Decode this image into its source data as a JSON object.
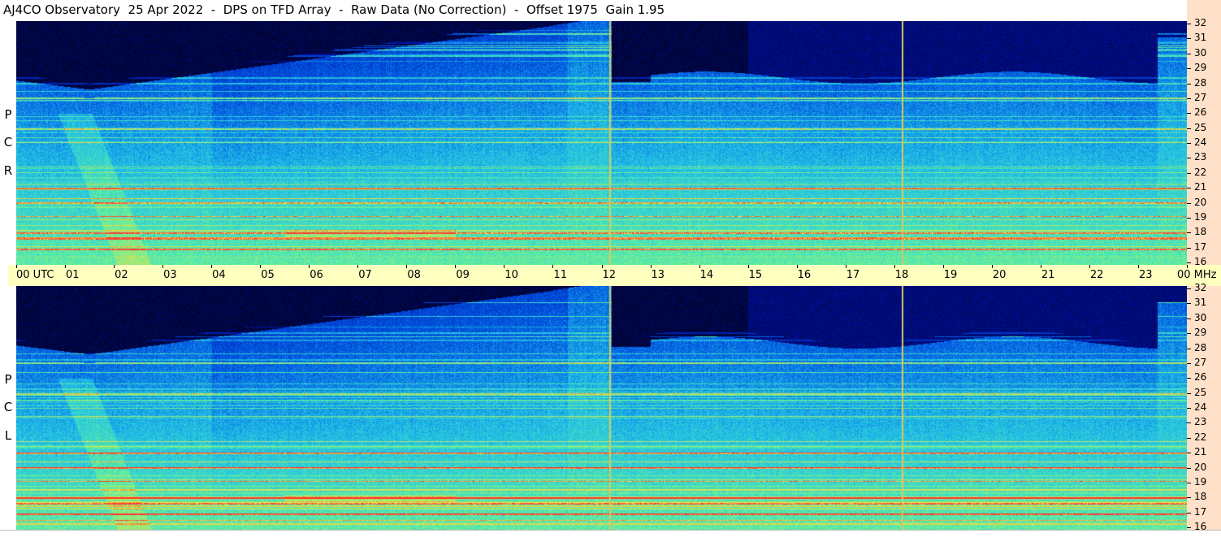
{
  "title": "AJ4CO Observatory  25 Apr 2022  -  DPS on TFD Array  -  Raw Data (No Correction)  -  Offset 1975  Gain 1.95",
  "panels": [
    {
      "id": "rcp",
      "label_letters": [
        "R",
        "C",
        "P"
      ]
    },
    {
      "id": "lcp",
      "label_letters": [
        "L",
        "C",
        "P"
      ]
    }
  ],
  "time_axis": {
    "labels": [
      "00 UTC",
      "01",
      "02",
      "03",
      "04",
      "05",
      "06",
      "07",
      "08",
      "09",
      "10",
      "11",
      "12",
      "13",
      "14",
      "15",
      "16",
      "17",
      "18",
      "19",
      "20",
      "21",
      "22",
      "23",
      "00 MHz"
    ],
    "unit": "UTC"
  },
  "freq_axis": {
    "labels": [
      "32",
      "31",
      "30",
      "29",
      "28",
      "27",
      "26",
      "25",
      "24",
      "23",
      "22",
      "21",
      "20",
      "19",
      "18",
      "17",
      "16"
    ],
    "unit": "MHz",
    "range": [
      16,
      32
    ]
  },
  "chart_data": {
    "type": "heatmap",
    "title": "AJ4CO Observatory  25 Apr 2022  -  DPS on TFD Array  -  Raw Data (No Correction)  -  Offset 1975  Gain 1.95",
    "x": {
      "label": "UTC",
      "range_hours": [
        0,
        24
      ]
    },
    "y": {
      "label": "MHz",
      "range": [
        16,
        32
      ]
    },
    "series": [
      {
        "name": "RCP"
      },
      {
        "name": "LCP"
      }
    ],
    "marker_lines_utc": [
      12.15,
      18.15
    ],
    "colormap": [
      "#000010",
      "#0010a0",
      "#0050e0",
      "#20c0e8",
      "#60f0a0",
      "#f0e040",
      "#ff3030"
    ]
  }
}
